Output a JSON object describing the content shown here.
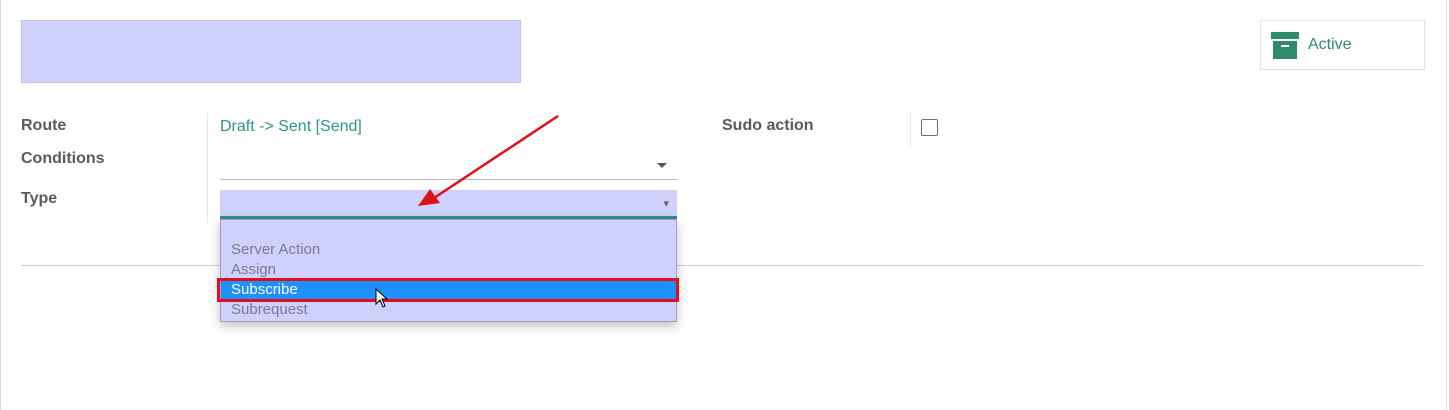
{
  "status": {
    "label": "Active",
    "color": "#2e8b6e"
  },
  "form": {
    "route_label": "Route",
    "route_value": "Draft -> Sent [Send]",
    "conditions_label": "Conditions",
    "conditions_value": "",
    "type_label": "Type",
    "type_value": "",
    "sudo_label": "Sudo action",
    "sudo_checked": false
  },
  "type_dropdown": {
    "options": [
      {
        "label": ""
      },
      {
        "label": "Server Action"
      },
      {
        "label": "Assign"
      },
      {
        "label": "Subscribe",
        "selected": true
      },
      {
        "label": "Subrequest"
      }
    ]
  },
  "annotation": {
    "highlight_color": "#e0101a",
    "arrow_color": "#e0101a"
  }
}
